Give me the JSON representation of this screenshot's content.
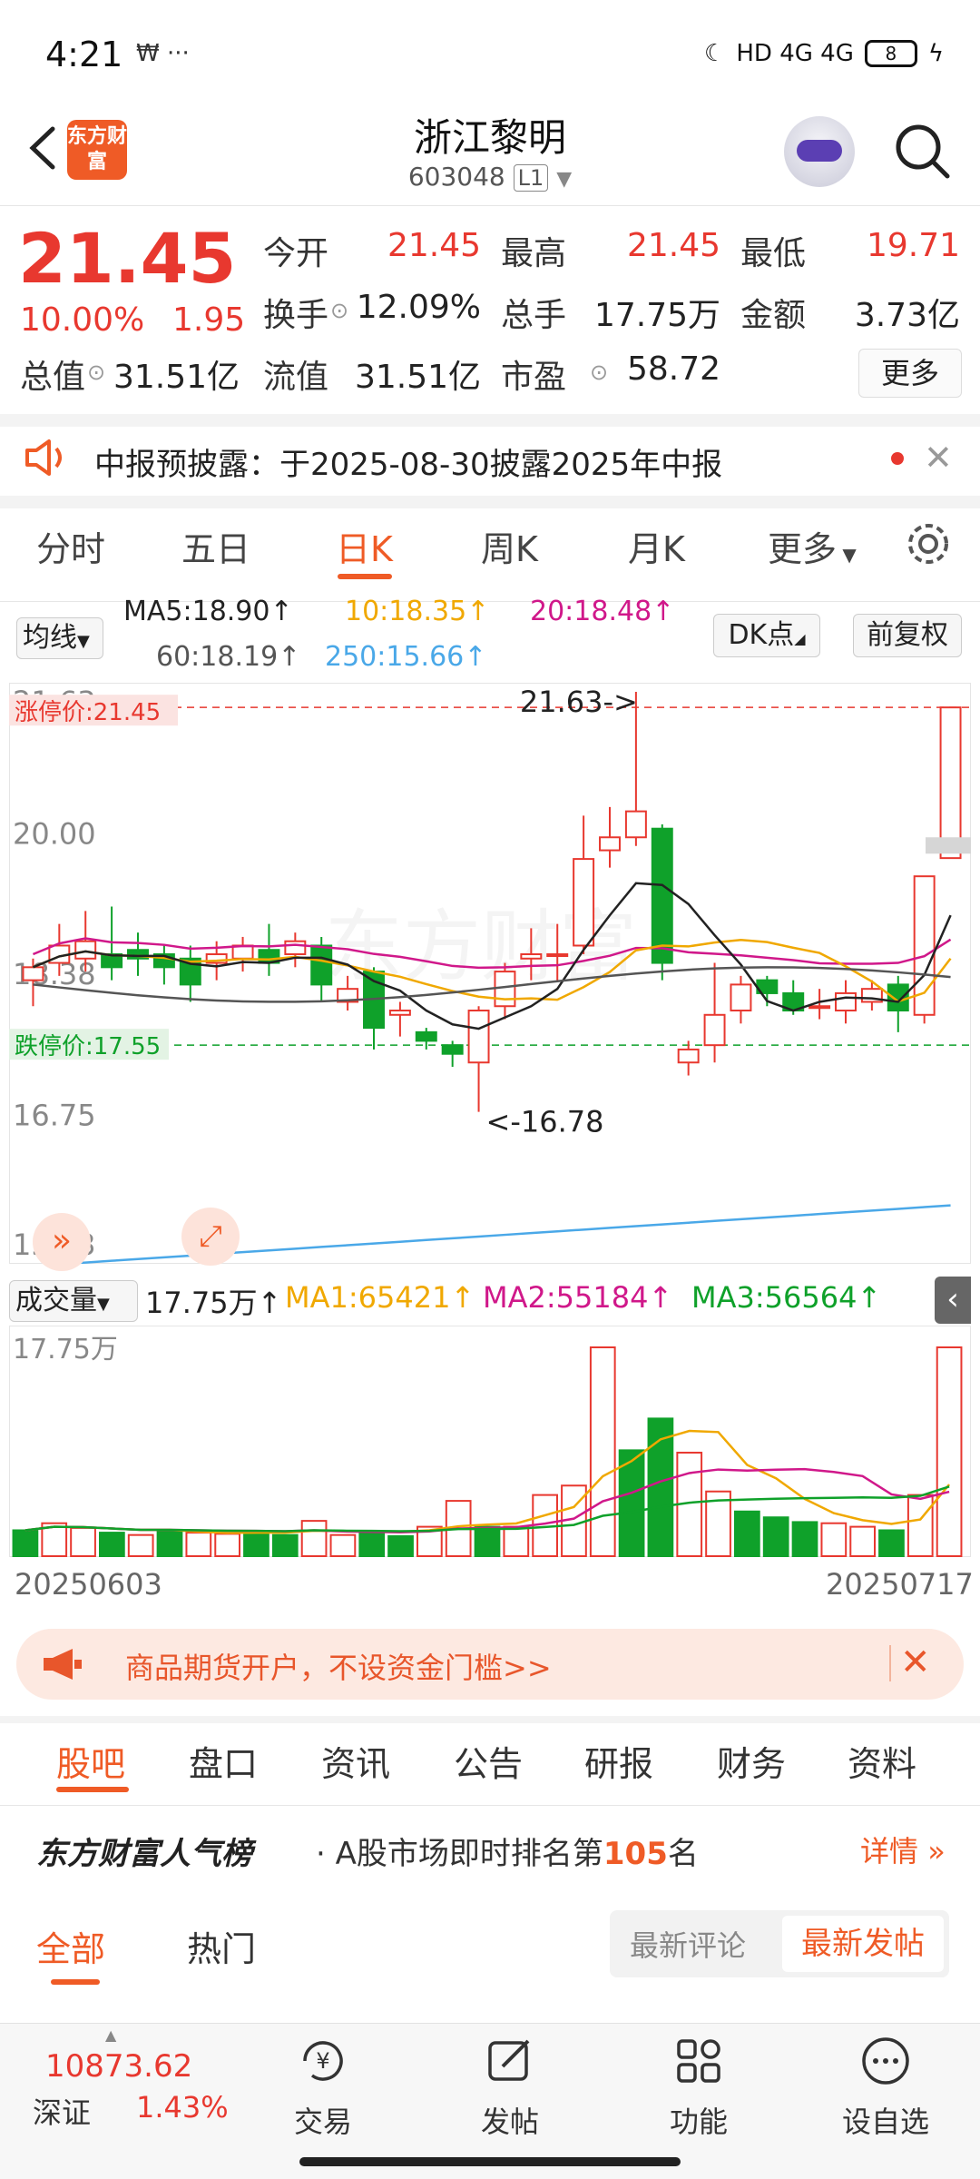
{
  "status": {
    "time": "4:21",
    "icons": "₩ ···",
    "network": "HD 4G 4G",
    "battery": "8"
  },
  "header": {
    "logo_text": "东方财富",
    "name": "浙江黎明",
    "code": "603048",
    "level": "L1"
  },
  "quote": {
    "price": "21.45",
    "change_pct": "10.00%",
    "change_amt": "1.95",
    "rows": [
      [
        {
          "label": "今开",
          "value": "21.45",
          "color": "red"
        },
        {
          "label": "最高",
          "value": "21.45",
          "color": "red"
        },
        {
          "label": "最低",
          "value": "19.71",
          "color": "red"
        }
      ],
      [
        {
          "label": "换手",
          "value": "12.09%",
          "color": "dark"
        },
        {
          "label": "总手",
          "value": "17.75万",
          "color": "dark"
        },
        {
          "label": "金额",
          "value": "3.73亿",
          "color": "dark"
        }
      ],
      [
        {
          "label": "总值",
          "value": "31.51亿",
          "color": "dark"
        },
        {
          "label": "流值",
          "value": "31.51亿",
          "color": "dark"
        },
        {
          "label": "市盈",
          "value": "58.72",
          "color": "dark"
        }
      ]
    ],
    "more": "更多"
  },
  "notice": {
    "text": "中报预披露：于2025-08-30披露2025年中报"
  },
  "ktabs": [
    "分时",
    "五日",
    "日K",
    "周K",
    "月K",
    "更多"
  ],
  "ma_legend": {
    "button": "均线",
    "ma5": "MA5:18.90↑",
    "ma10": "10:18.35↑",
    "ma20": "20:18.48↑",
    "ma60": "60:18.19↑",
    "ma250": "250:15.66↑",
    "dk": "DK点",
    "fq": "前复权"
  },
  "colors": {
    "up": "#e8382f",
    "down": "#0fa12a",
    "accent": "#ef5b26",
    "ma5": "#222222",
    "ma10": "#f0a800",
    "ma20": "#d0188a",
    "ma60": "#555555",
    "ma250": "#4aa8e8"
  },
  "chart_labels": {
    "limit_up": "涨停价:21.45",
    "limit_down": "跌停价:17.55",
    "y_ticks": [
      "21.63",
      "20.00",
      "18.38",
      "16.75",
      "15.13"
    ],
    "high_mark": "21.63->",
    "low_mark": "<-16.78"
  },
  "volume_legend": {
    "button": "成交量",
    "vol": "17.75万↑",
    "ma1": "MA1:65421↑",
    "ma2": "MA2:55184↑",
    "ma3": "MA3:56564↑",
    "axis_max": "17.75万"
  },
  "dates": {
    "start": "20250603",
    "end": "20250717"
  },
  "chart_data": {
    "type": "candlestick",
    "ylim": [
      15.13,
      21.63
    ],
    "candles": [
      [
        18.3,
        18.45,
        18.0,
        18.55
      ],
      [
        18.5,
        18.7,
        18.35,
        18.95
      ],
      [
        18.55,
        18.75,
        18.4,
        19.1
      ],
      [
        18.6,
        18.45,
        18.3,
        19.15
      ],
      [
        18.65,
        18.55,
        18.35,
        18.85
      ],
      [
        18.6,
        18.45,
        18.25,
        18.7
      ],
      [
        18.55,
        18.25,
        18.05,
        18.7
      ],
      [
        18.5,
        18.6,
        18.3,
        18.75
      ],
      [
        18.55,
        18.7,
        18.4,
        18.8
      ],
      [
        18.65,
        18.5,
        18.35,
        18.95
      ],
      [
        18.6,
        18.75,
        18.45,
        18.85
      ],
      [
        18.7,
        18.25,
        18.05,
        18.8
      ],
      [
        18.05,
        18.2,
        17.95,
        18.35
      ],
      [
        18.4,
        17.75,
        17.5,
        18.45
      ],
      [
        17.9,
        17.95,
        17.65,
        18.05
      ],
      [
        17.7,
        17.6,
        17.5,
        17.75
      ],
      [
        17.55,
        17.45,
        17.3,
        17.6
      ],
      [
        17.35,
        17.95,
        16.78,
        18.0
      ],
      [
        18.0,
        18.4,
        17.85,
        18.5
      ],
      [
        18.55,
        18.6,
        18.3,
        18.9
      ],
      [
        18.6,
        18.6,
        18.3,
        18.95
      ],
      [
        18.7,
        19.7,
        18.6,
        20.2
      ],
      [
        19.8,
        19.95,
        19.6,
        20.3
      ],
      [
        19.95,
        20.25,
        19.85,
        21.63
      ],
      [
        20.05,
        18.5,
        18.3,
        20.1
      ],
      [
        17.35,
        17.5,
        17.2,
        17.6
      ],
      [
        17.55,
        17.9,
        17.35,
        18.5
      ],
      [
        17.95,
        18.25,
        17.8,
        18.35
      ],
      [
        18.3,
        18.15,
        18.0,
        18.35
      ],
      [
        18.15,
        17.95,
        17.9,
        18.3
      ],
      [
        18.0,
        18.0,
        17.85,
        18.2
      ],
      [
        17.95,
        18.15,
        17.8,
        18.3
      ],
      [
        18.05,
        18.2,
        17.95,
        18.3
      ],
      [
        18.25,
        17.95,
        17.7,
        18.35
      ],
      [
        17.9,
        19.5,
        17.8,
        19.5
      ],
      [
        19.71,
        21.45,
        19.71,
        21.45
      ]
    ],
    "volume_max": 177500,
    "volumes": [
      [
        22000,
        "down"
      ],
      [
        28000,
        "up"
      ],
      [
        24000,
        "up"
      ],
      [
        20000,
        "down"
      ],
      [
        18000,
        "up"
      ],
      [
        22000,
        "down"
      ],
      [
        20000,
        "up"
      ],
      [
        19000,
        "up"
      ],
      [
        21000,
        "down"
      ],
      [
        18000,
        "down"
      ],
      [
        30000,
        "up"
      ],
      [
        18000,
        "up"
      ],
      [
        20000,
        "down"
      ],
      [
        17000,
        "down"
      ],
      [
        25000,
        "up"
      ],
      [
        47000,
        "up"
      ],
      [
        25000,
        "down"
      ],
      [
        25000,
        "up"
      ],
      [
        52000,
        "up"
      ],
      [
        60000,
        "up"
      ],
      [
        177500,
        "up"
      ],
      [
        90000,
        "down"
      ],
      [
        117000,
        "down"
      ],
      [
        88000,
        "up"
      ],
      [
        55000,
        "up"
      ],
      [
        38000,
        "down"
      ],
      [
        33000,
        "down"
      ],
      [
        29000,
        "down"
      ],
      [
        28000,
        "up"
      ],
      [
        25000,
        "up"
      ],
      [
        22000,
        "down"
      ],
      [
        52000,
        "up"
      ],
      [
        177500,
        "up"
      ]
    ]
  },
  "banner": {
    "text": "商品期货开户，不设资金门槛>>"
  },
  "bottom_tabs": [
    "股吧",
    "盘口",
    "资讯",
    "公告",
    "研报",
    "财务",
    "资料"
  ],
  "ranking": {
    "title": "东方财富人气榜",
    "prefix": "· A股市场即时排名第",
    "rank": "105",
    "suffix": "名",
    "detail": "详情"
  },
  "feed_tabs": {
    "all": "全部",
    "hot": "热门",
    "sort_comment": "最新评论",
    "sort_post": "最新发帖"
  },
  "index_bar": {
    "value": "10873.62",
    "name": "深证",
    "pct": "1.43%"
  },
  "nav": [
    "交易",
    "发帖",
    "功能",
    "设自选"
  ]
}
